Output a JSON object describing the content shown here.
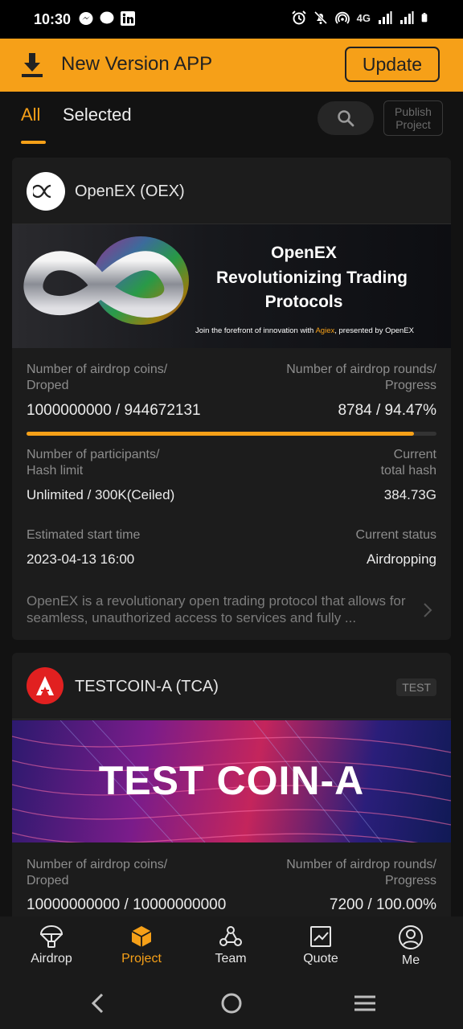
{
  "status_bar": {
    "time": "10:30",
    "network": "4G",
    "left_icons": [
      "messenger-icon",
      "chat-icon",
      "linkedin-icon"
    ],
    "right_icons": [
      "alarm-icon",
      "mute-icon",
      "hotspot-icon",
      "signal-icon",
      "battery-icon"
    ]
  },
  "banner": {
    "text": "New Version APP",
    "button": "Update"
  },
  "tabs": {
    "all": "All",
    "selected": "Selected",
    "publish_line1": "Publish",
    "publish_line2": "Project"
  },
  "projects": [
    {
      "name": "OpenEX (OEX)",
      "banner_line1": "OpenEX",
      "banner_line2": "Revolutionizing Trading",
      "banner_line3": "Protocols",
      "banner_sub_pre": "Join the forefront of innovation with ",
      "banner_sub_brand": "Agiex",
      "banner_sub_post": ", presented by OpenEX",
      "airdrop_coins_label1": "Number of airdrop coins/",
      "airdrop_coins_label2": "Droped",
      "airdrop_coins_value": "1000000000 / 944672131",
      "rounds_label1": "Number of airdrop rounds/",
      "rounds_label2": "Progress",
      "rounds_value": "8784 / 94.47%",
      "progress": 0.9447,
      "participants_label1": "Number of participants/",
      "participants_label2": "Hash limit",
      "participants_value": "Unlimited / 300K(Ceiled)",
      "hash_label1": "Current",
      "hash_label2": "total hash",
      "hash_value": "384.73G",
      "start_label": "Estimated start time",
      "start_value": "2023-04-13 16:00",
      "status_label": "Current status",
      "status_value": "Airdropping",
      "description": "OpenEX is a revolutionary open trading protocol that allows for seamless, unauthorized access to services and fully ..."
    },
    {
      "name": "TESTCOIN-A (TCA)",
      "badge": "TEST",
      "banner_text": "TEST COIN-A",
      "airdrop_coins_label1": "Number of airdrop coins/",
      "airdrop_coins_label2": "Droped",
      "airdrop_coins_value": "10000000000 / 10000000000",
      "rounds_label1": "Number of airdrop rounds/",
      "rounds_label2": "Progress",
      "rounds_value": "7200 / 100.00%"
    }
  ],
  "bottom_nav": [
    {
      "label": "Airdrop",
      "icon": "parachute-icon"
    },
    {
      "label": "Project",
      "icon": "cube-icon",
      "active": true
    },
    {
      "label": "Team",
      "icon": "team-icon"
    },
    {
      "label": "Quote",
      "icon": "chart-icon"
    },
    {
      "label": "Me",
      "icon": "user-icon"
    }
  ],
  "colors": {
    "accent": "#f6a018",
    "background": "#121212",
    "card": "#1c1c1c"
  }
}
